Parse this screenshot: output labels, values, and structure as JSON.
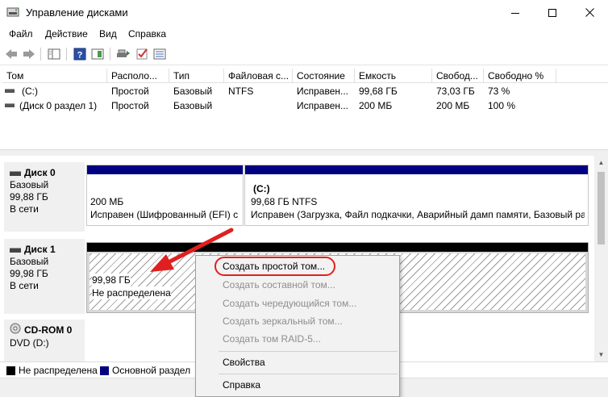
{
  "window": {
    "title": "Управление дисками"
  },
  "menu": {
    "file": "Файл",
    "action": "Действие",
    "view": "Вид",
    "help": "Справка"
  },
  "volume_table": {
    "columns": [
      "Том",
      "Располо...",
      "Тип",
      "Файловая с...",
      "Состояние",
      "Емкость",
      "Свобод...",
      "Свободно %"
    ],
    "rows": [
      {
        "volume": "(C:)",
        "layout": "Простой",
        "type": "Базовый",
        "fs": "NTFS",
        "status": "Исправен...",
        "capacity": "99,68 ГБ",
        "free": "73,03 ГБ",
        "free_pct": "73 %"
      },
      {
        "volume": "(Диск 0 раздел 1)",
        "layout": "Простой",
        "type": "Базовый",
        "fs": "",
        "status": "Исправен...",
        "capacity": "200 МБ",
        "free": "200 МБ",
        "free_pct": "100 %"
      }
    ]
  },
  "disks": {
    "disk0": {
      "name": "Диск 0",
      "type": "Базовый",
      "size": "99,88 ГБ",
      "state": "В сети",
      "partitions": [
        {
          "size": "200 МБ",
          "status": "Исправен (Шифрованный (EFI) с"
        },
        {
          "label": "(C:)",
          "size": "99,68 ГБ NTFS",
          "status": "Исправен (Загрузка, Файл подкачки, Аварийный дамп памяти, Базовый раз"
        }
      ]
    },
    "disk1": {
      "name": "Диск 1",
      "type": "Базовый",
      "size": "99,98 ГБ",
      "state": "В сети",
      "partition": {
        "size": "99,98 ГБ",
        "status": "Не распределена"
      }
    },
    "cdrom0": {
      "name": "CD-ROM 0",
      "drive": "DVD (D:)"
    }
  },
  "legend": {
    "unallocated": "Не распределена",
    "primary": "Основной раздел"
  },
  "context_menu": {
    "items": [
      {
        "label": "Создать простой том...",
        "enabled": true
      },
      {
        "label": "Создать составной том...",
        "enabled": false
      },
      {
        "label": "Создать чередующийся том...",
        "enabled": false
      },
      {
        "label": "Создать зеркальный том...",
        "enabled": false
      },
      {
        "label": "Создать том RAID-5...",
        "enabled": false
      },
      {
        "label": "Свойства",
        "enabled": true
      },
      {
        "label": "Справка",
        "enabled": true
      }
    ]
  },
  "colors": {
    "primary_partition": "#000080",
    "unallocated": "#000000",
    "highlight": "#e02020"
  }
}
